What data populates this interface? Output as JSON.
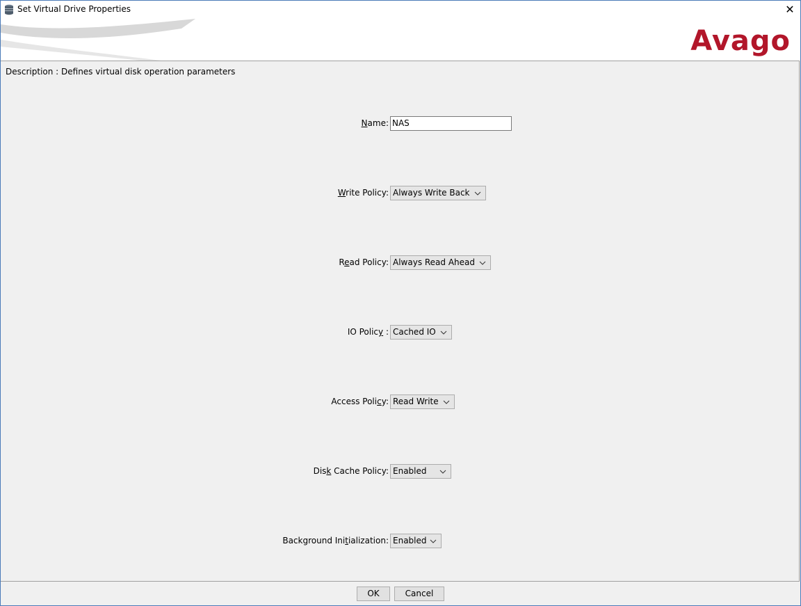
{
  "window": {
    "title": "Set Virtual Drive Properties",
    "close_symbol": "✕"
  },
  "banner": {
    "logo_text": "Avago",
    "logo_color": "#b2162a"
  },
  "description": "Description : Defines virtual disk operation parameters",
  "fields": {
    "name": {
      "label_pre": "",
      "label_ul": "N",
      "label_post": "ame:",
      "value": "NAS"
    },
    "write_policy": {
      "label_pre": "",
      "label_ul": "W",
      "label_post": "rite Policy:",
      "value": "Always Write Back"
    },
    "read_policy": {
      "label_pre": "R",
      "label_ul": "e",
      "label_post": "ad Policy:",
      "value": "Always Read Ahead"
    },
    "io_policy": {
      "label_pre": "IO Polic",
      "label_ul": "y",
      "label_post": " :",
      "value": "Cached IO"
    },
    "access_policy": {
      "label_pre": "Access Poli",
      "label_ul": "c",
      "label_post": "y:",
      "value": "Read Write"
    },
    "disk_cache_policy": {
      "label_pre": "Dis",
      "label_ul": "k",
      "label_post": " Cache Policy:",
      "value": "Enabled"
    },
    "background_init": {
      "label_pre": "Background Ini",
      "label_ul": "t",
      "label_post": "ialization:",
      "value": "Enabled"
    }
  },
  "buttons": {
    "ok": "OK",
    "cancel": "Cancel"
  },
  "icons": {
    "app": "database-icon",
    "close": "close-icon",
    "dropdown": "chevron-down-icon"
  }
}
